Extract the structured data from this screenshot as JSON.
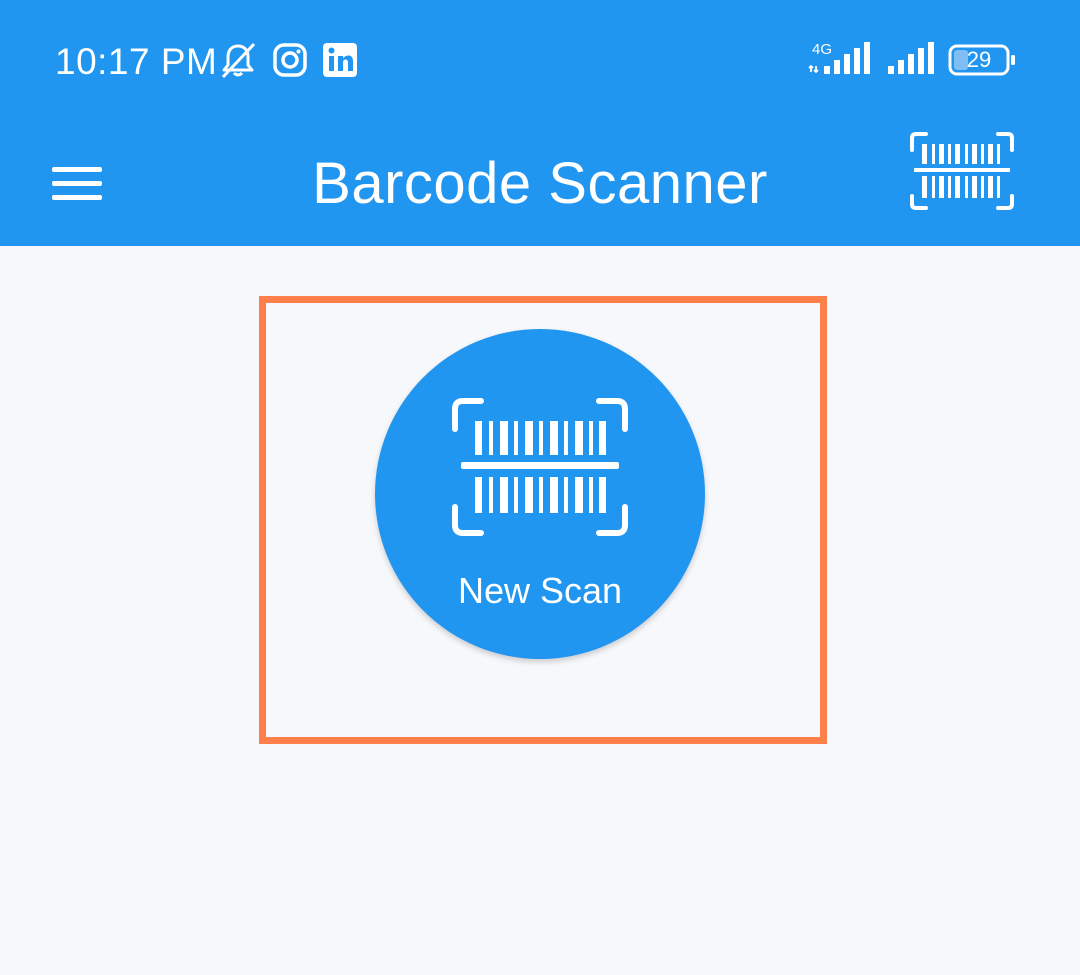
{
  "status_bar": {
    "time": "10:17 PM",
    "network_label": "4G",
    "battery_level": "29",
    "icons": [
      "bell-off-icon",
      "instagram-icon",
      "linkedin-icon",
      "signal-4g-icon",
      "signal-icon",
      "battery-icon"
    ]
  },
  "app_bar": {
    "title": "Barcode Scanner",
    "menu_icon": "hamburger-menu-icon",
    "action_icon": "barcode-scan-icon"
  },
  "main": {
    "scan_button_label": "New Scan",
    "scan_button_icon": "barcode-scan-icon"
  },
  "colors": {
    "primary": "#2196f0",
    "background": "#f7f8fc",
    "highlight": "#ff7f4a",
    "on_primary": "#ffffff"
  }
}
